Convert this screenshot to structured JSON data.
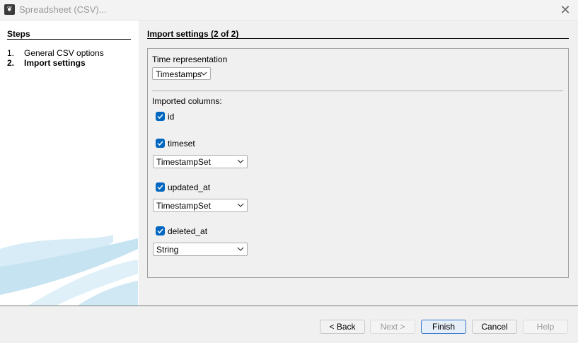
{
  "window": {
    "title": "Spreadsheet (CSV)...",
    "app_icon": "gephi-app-icon",
    "close_icon": "close-icon"
  },
  "steps": {
    "heading": "Steps",
    "items": [
      {
        "num": "1.",
        "label": "General CSV options",
        "active": false
      },
      {
        "num": "2.",
        "label": "Import settings",
        "active": true
      }
    ]
  },
  "main": {
    "heading": "Import settings (2 of 2)",
    "time_representation": {
      "label": "Time representation",
      "value": "Timestamps"
    },
    "imported_columns_label": "Imported columns:",
    "columns": [
      {
        "name": "id",
        "checked": true,
        "type": null
      },
      {
        "name": "timeset",
        "checked": true,
        "type": "TimestampSet"
      },
      {
        "name": "updated_at",
        "checked": true,
        "type": "TimestampSet"
      },
      {
        "name": "deleted_at",
        "checked": true,
        "type": "String"
      }
    ]
  },
  "buttons": {
    "back": "< Back",
    "next": "Next >",
    "finish": "Finish",
    "cancel": "Cancel",
    "help": "Help"
  },
  "colors": {
    "checkbox": "#0067c0",
    "panel_bg": "#f0f0f0",
    "primary_border": "#3478c8"
  }
}
